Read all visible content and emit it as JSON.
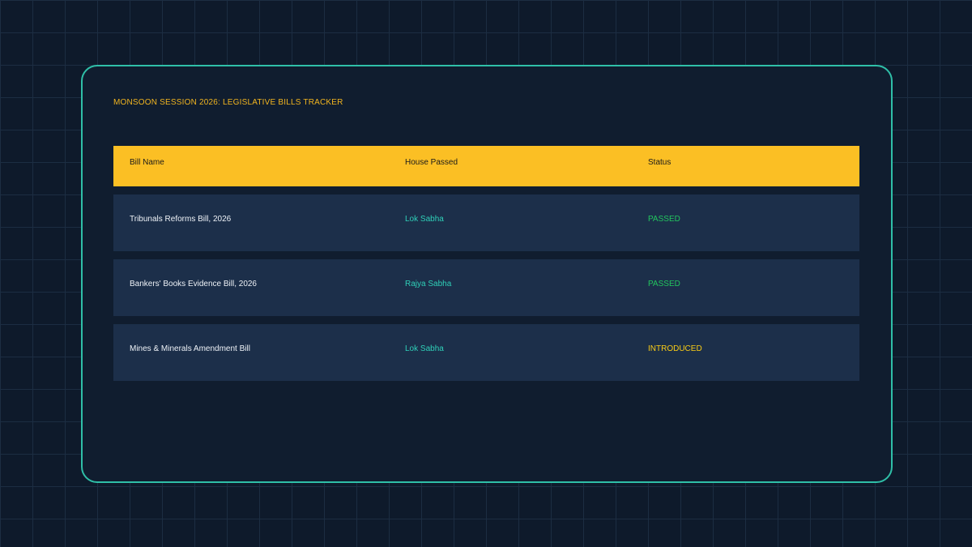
{
  "title": "MONSOON SESSION 2026: LEGISLATIVE BILLS TRACKER",
  "table": {
    "headers": [
      "Bill Name",
      "House Passed",
      "Status"
    ],
    "rows": [
      {
        "bill": "Tribunals Reforms Bill, 2026",
        "house": "Lok Sabha",
        "status": "PASSED"
      },
      {
        "bill": "Bankers' Books Evidence Bill, 2026",
        "house": "Rajya Sabha",
        "status": "PASSED"
      },
      {
        "bill": "Mines & Minerals Amendment Bill",
        "house": "Lok Sabha",
        "status": "INTRODUCED"
      }
    ]
  },
  "colors": {
    "accent": "#fbbf24",
    "border": "#2fbfa8",
    "passed": "#22c55e",
    "introduced": "#facc15",
    "house": "#2fd0b8"
  }
}
